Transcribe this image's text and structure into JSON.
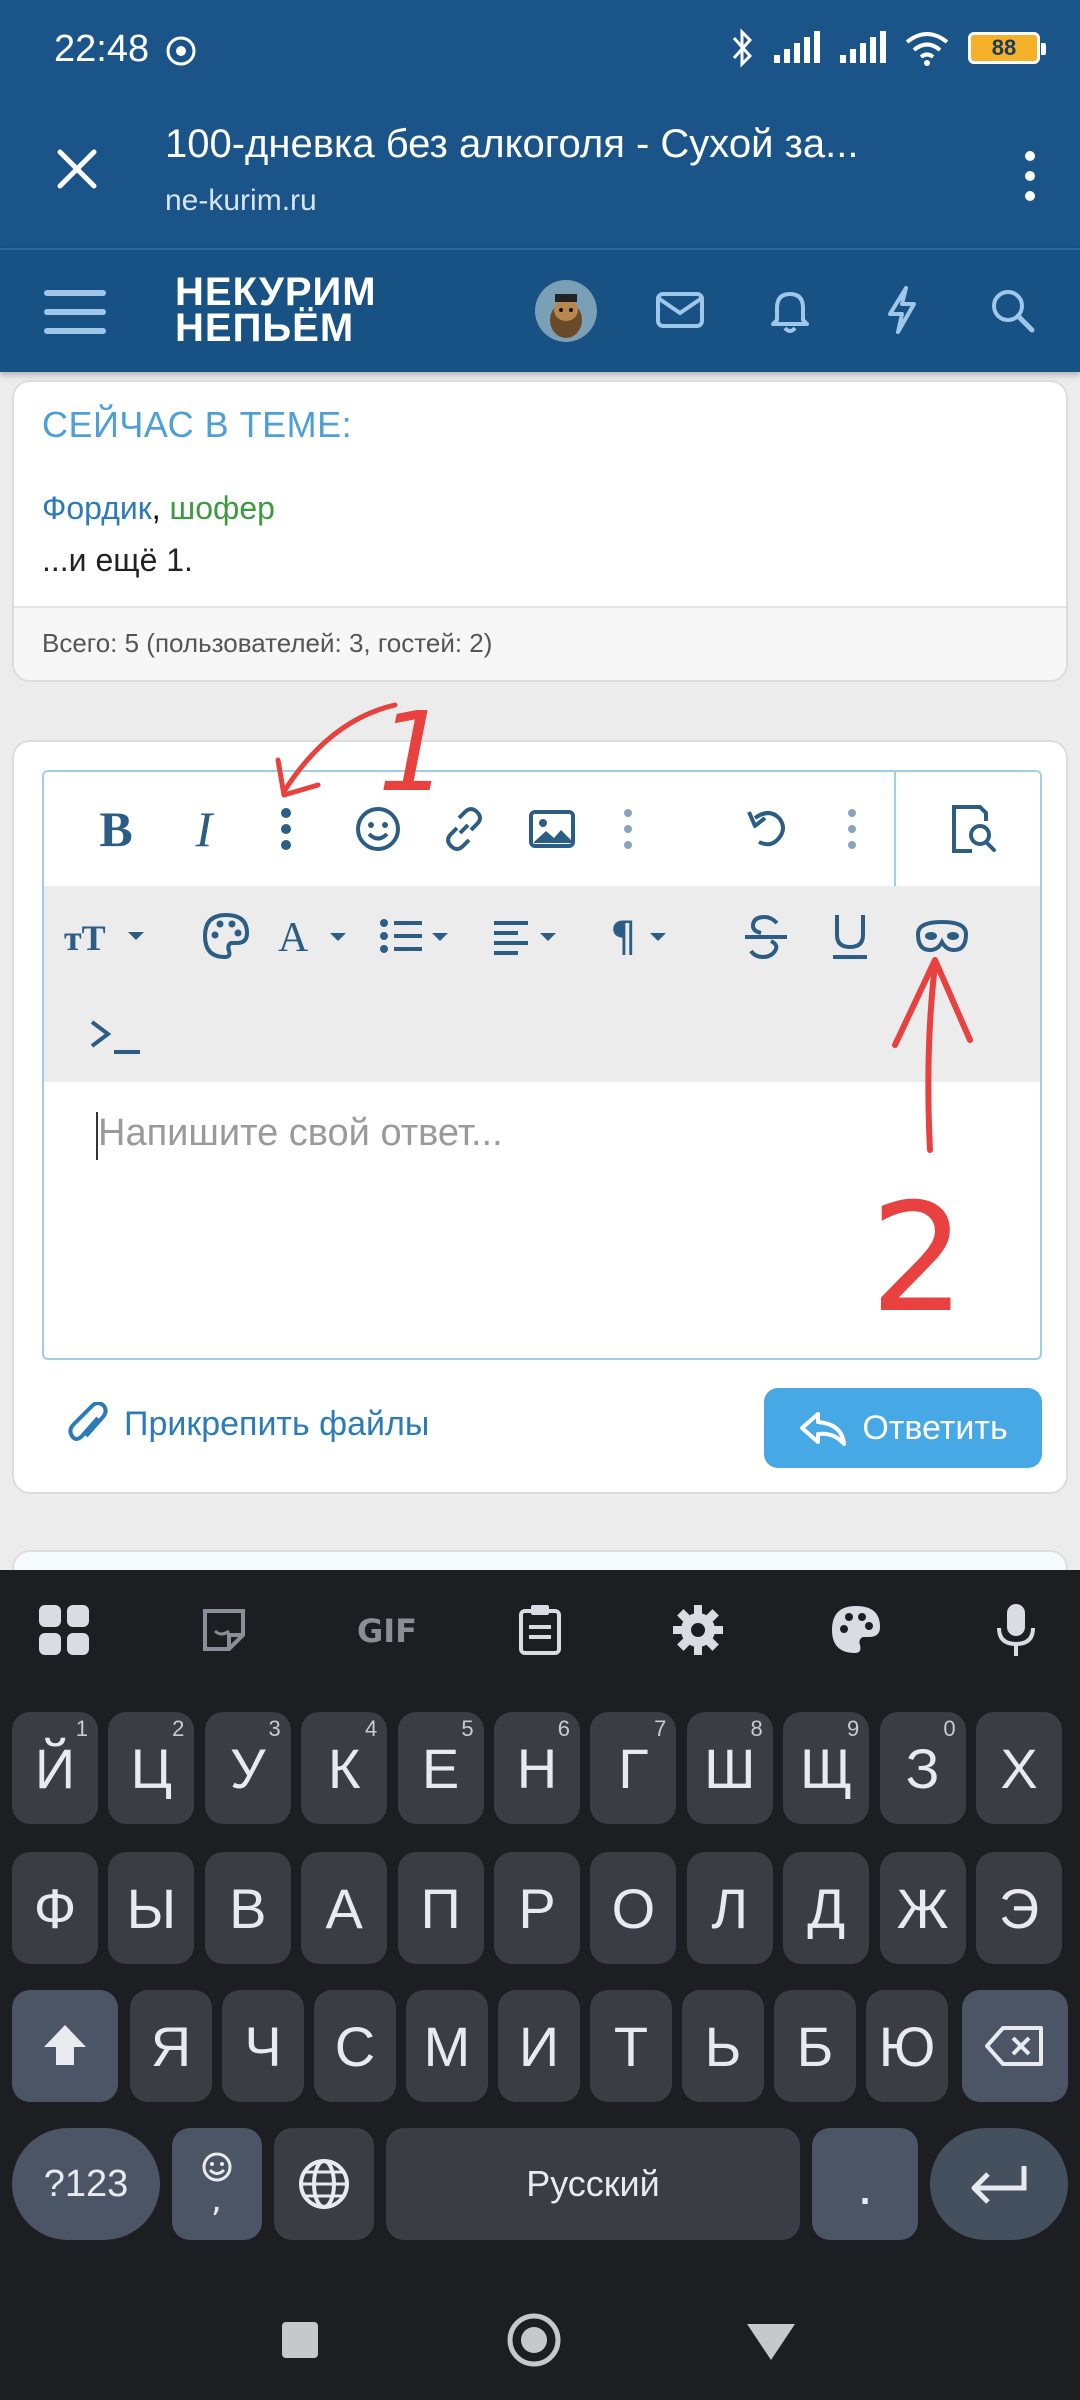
{
  "status": {
    "time": "22:48",
    "battery": "88"
  },
  "tab": {
    "title": "100-дневка без алкоголя - Сухой за...",
    "url": "ne-kurim.ru"
  },
  "site": {
    "logo_line1": "НЕКУРИМ",
    "logo_line2": "НЕПЬЁМ"
  },
  "in_topic": {
    "title": "СЕЙЧАС В ТЕМЕ:",
    "user1": "Фордик",
    "separator": ", ",
    "user2": "шофер",
    "more": "...и ещё 1.",
    "total": "Всего: 5 (пользователей: 3, гостей: 2)"
  },
  "editor": {
    "bold": "B",
    "italic": "I",
    "placeholder": "Напишите свой ответ...",
    "attach": "Прикрепить файлы",
    "reply": "Ответить"
  },
  "annotations": {
    "one": "1",
    "two": "2"
  },
  "keyboard": {
    "row1": [
      {
        "k": "Й",
        "h": "1"
      },
      {
        "k": "Ц",
        "h": "2"
      },
      {
        "k": "У",
        "h": "3"
      },
      {
        "k": "К",
        "h": "4"
      },
      {
        "k": "Е",
        "h": "5"
      },
      {
        "k": "Н",
        "h": "6"
      },
      {
        "k": "Г",
        "h": "7"
      },
      {
        "k": "Ш",
        "h": "8"
      },
      {
        "k": "Щ",
        "h": "9"
      },
      {
        "k": "З",
        "h": "0"
      },
      {
        "k": "Х",
        "h": ""
      }
    ],
    "row2": [
      "Ф",
      "Ы",
      "В",
      "А",
      "П",
      "Р",
      "О",
      "Л",
      "Д",
      "Ж",
      "Э"
    ],
    "row3": [
      "Я",
      "Ч",
      "С",
      "М",
      "И",
      "Т",
      "Ь",
      "Б",
      "Ю"
    ],
    "symbols": "?123",
    "space": "Русский",
    "period": ".",
    "comma": ","
  },
  "colors": {
    "header": "#1a5488",
    "accent": "#46a9e6",
    "annotation": "#e8413f"
  }
}
